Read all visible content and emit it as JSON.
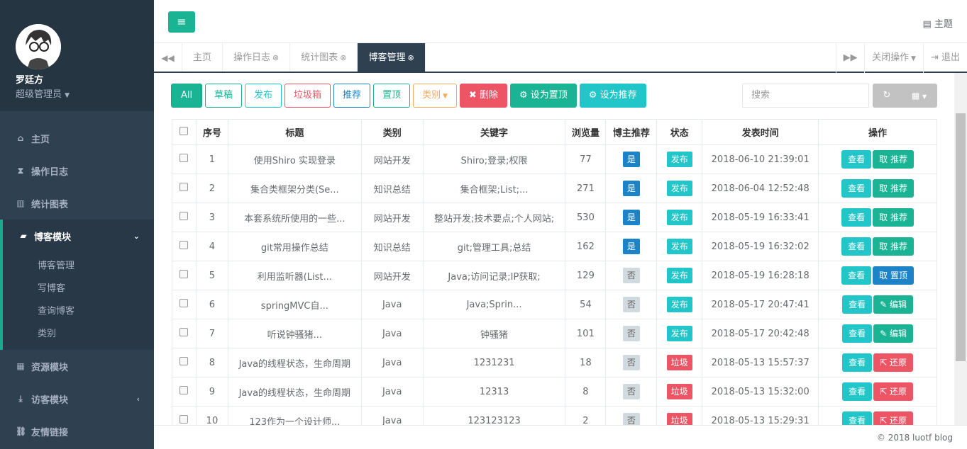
{
  "sidebar": {
    "user": {
      "name": "罗廷方",
      "role": "超级管理员"
    },
    "items": [
      {
        "label": "主页"
      },
      {
        "label": "操作日志"
      },
      {
        "label": "统计图表"
      },
      {
        "label": "博客模块"
      },
      {
        "label": "资源模块"
      },
      {
        "label": "访客模块"
      },
      {
        "label": "友情链接"
      }
    ],
    "sub_items": [
      {
        "label": "博客管理"
      },
      {
        "label": "写博客"
      },
      {
        "label": "查询博客"
      },
      {
        "label": "类别"
      }
    ]
  },
  "header": {
    "theme_label": "主题"
  },
  "tabs": [
    {
      "label": "主页"
    },
    {
      "label": "操作日志"
    },
    {
      "label": "统计图表"
    },
    {
      "label": "博客管理"
    }
  ],
  "tab_actions": {
    "close_ops": "关闭操作",
    "logout": "退出"
  },
  "toolbar": {
    "all": "All",
    "draft": "草稿",
    "publish": "发布",
    "trash": "垃圾箱",
    "recommend": "推荐",
    "top": "置顶",
    "category": "类别",
    "delete": "删除",
    "set_top": "设为置顶",
    "set_recommend": "设为推荐"
  },
  "search": {
    "placeholder": "搜索"
  },
  "table": {
    "headers": [
      "序号",
      "标题",
      "类别",
      "关键字",
      "浏览量",
      "博主推荐",
      "状态",
      "发表时间",
      "操作"
    ],
    "rows": [
      {
        "no": "1",
        "title": "使用Shiro 实现登录",
        "category": "网站开发",
        "keywords": "Shiro;登录;权限",
        "views": "77",
        "rec": "是",
        "status": "发布",
        "time": "2018-06-10 21:39:01",
        "view": "查看",
        "action": "取 推荐"
      },
      {
        "no": "2",
        "title": "集合类框架分类(Se...",
        "category": "知识总结",
        "keywords": "集合框架;List;...",
        "views": "271",
        "rec": "是",
        "status": "发布",
        "time": "2018-06-04 12:52:48",
        "view": "查看",
        "action": "取 推荐"
      },
      {
        "no": "3",
        "title": "本套系统所使用的一些...",
        "category": "网站开发",
        "keywords": "整站开发;技术要点;个人网站;",
        "views": "530",
        "rec": "是",
        "status": "发布",
        "time": "2018-05-19 16:33:41",
        "view": "查看",
        "action": "取 推荐"
      },
      {
        "no": "4",
        "title": "git常用操作总结",
        "category": "知识总结",
        "keywords": "git;管理工具;总结",
        "views": "162",
        "rec": "是",
        "status": "发布",
        "time": "2018-05-19 16:32:02",
        "view": "查看",
        "action": "取 推荐"
      },
      {
        "no": "5",
        "title": "利用监听器(List...",
        "category": "网站开发",
        "keywords": "Java;访问记录;IP获取;",
        "views": "129",
        "rec": "否",
        "status": "发布",
        "time": "2018-05-19 16:28:18",
        "view": "查看",
        "action": "取 置顶"
      },
      {
        "no": "6",
        "title": "springMVC自...",
        "category": "Java",
        "keywords": "Java;Sprin...",
        "views": "54",
        "rec": "否",
        "status": "发布",
        "time": "2018-05-17 20:47:41",
        "view": "查看",
        "action": "编辑"
      },
      {
        "no": "7",
        "title": "听说钟骚猪...",
        "category": "Java",
        "keywords": "钟骚猪",
        "views": "101",
        "rec": "否",
        "status": "发布",
        "time": "2018-05-17 20:42:48",
        "view": "查看",
        "action": "编辑"
      },
      {
        "no": "8",
        "title": "Java的线程状态，生命周期",
        "category": "Java",
        "keywords": "1231231",
        "views": "18",
        "rec": "否",
        "status": "垃圾",
        "time": "2018-05-13 15:57:37",
        "view": "查看",
        "action": "还原"
      },
      {
        "no": "9",
        "title": "Java的线程状态，生命周期",
        "category": "Java",
        "keywords": "12313",
        "views": "8",
        "rec": "否",
        "status": "垃圾",
        "time": "2018-05-13 15:32:00",
        "view": "查看",
        "action": "还原"
      },
      {
        "no": "10",
        "title": "123作为一个设计师...",
        "category": "Java",
        "keywords": "123123123",
        "views": "2",
        "rec": "否",
        "status": "垃圾",
        "time": "2018-05-13 15:29:31",
        "view": "查看",
        "action": "还原"
      }
    ]
  },
  "footer": {
    "text": "© 2018 luotf blog"
  },
  "colors": {
    "sidebar": "#2f4050",
    "accent": "#1ab394",
    "info": "#23c6c8",
    "primary": "#1c84c6",
    "danger": "#ed5565"
  }
}
